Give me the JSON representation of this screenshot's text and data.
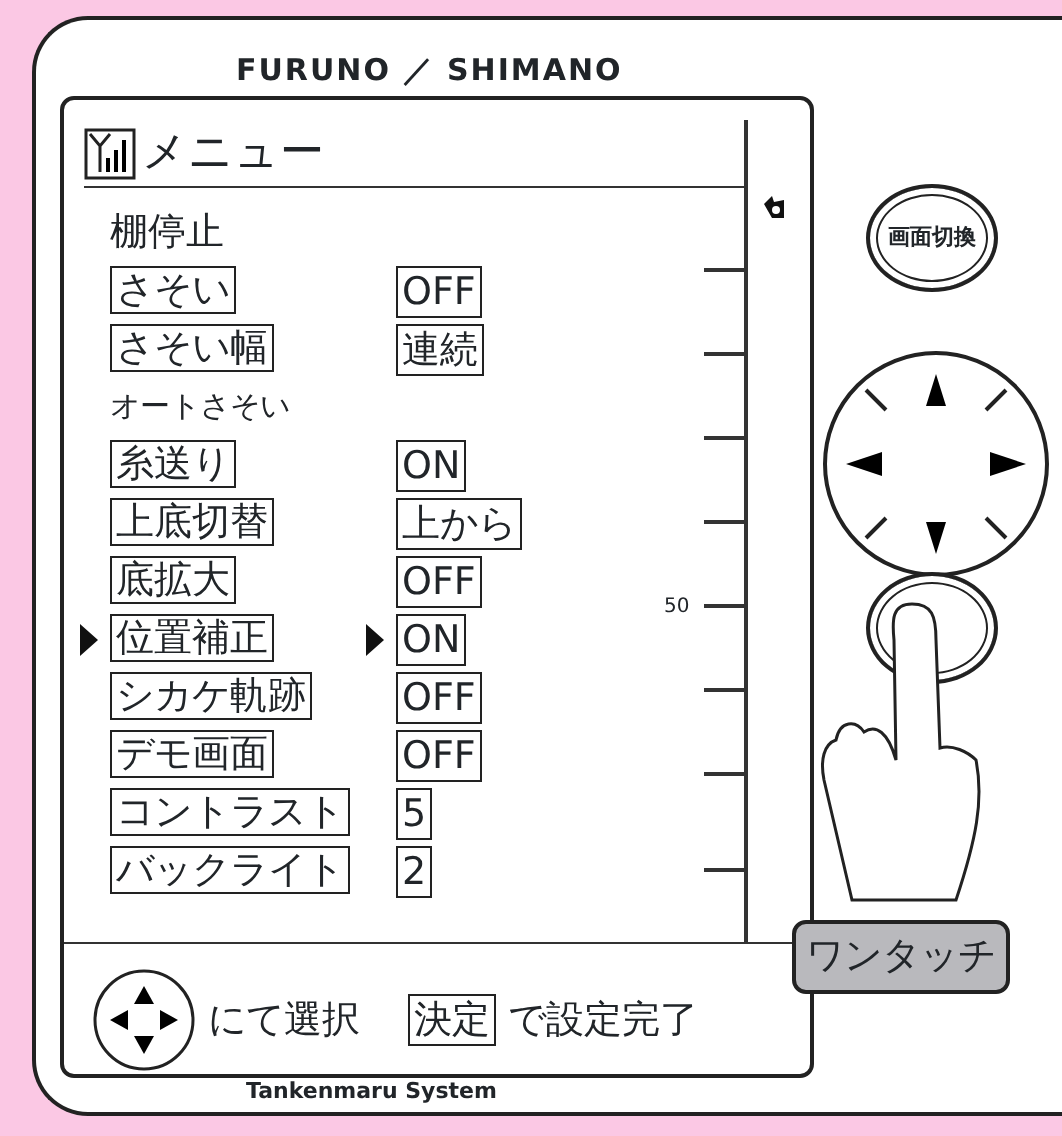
{
  "brand": {
    "left": "FURUNO",
    "separator": "／",
    "right": "SHIMANO"
  },
  "screen": {
    "title": "メニュー",
    "items": [
      {
        "kind": "section",
        "label": "棚停止"
      },
      {
        "kind": "setting",
        "label": "さそい",
        "value": "OFF",
        "selected": false
      },
      {
        "kind": "setting",
        "label": "さそい幅",
        "value": "連続",
        "selected": false
      },
      {
        "kind": "subsection",
        "label": "オートさそい"
      },
      {
        "kind": "setting",
        "label": "糸送り",
        "value": "ON",
        "selected": false
      },
      {
        "kind": "setting",
        "label": "上底切替",
        "value": "上から",
        "selected": false
      },
      {
        "kind": "setting",
        "label": "底拡大",
        "value": "OFF",
        "selected": false
      },
      {
        "kind": "setting",
        "label": "位置補正",
        "value": "ON",
        "selected": true
      },
      {
        "kind": "setting",
        "label": "シカケ軌跡",
        "value": "OFF",
        "selected": false
      },
      {
        "kind": "setting",
        "label": "デモ画面",
        "value": "OFF",
        "selected": false
      },
      {
        "kind": "setting",
        "label": "コントラスト",
        "value": "5",
        "selected": false
      },
      {
        "kind": "setting",
        "label": "バックライト",
        "value": "2",
        "selected": false
      }
    ],
    "scale_label": "50",
    "footer": {
      "select_text": "にて選択",
      "key_label": "決定",
      "confirm_text": "で設定完了"
    }
  },
  "buttons": {
    "screen_switch": "画面切換",
    "one_touch": "ワンタッチ"
  },
  "model": "Tankenmaru System"
}
